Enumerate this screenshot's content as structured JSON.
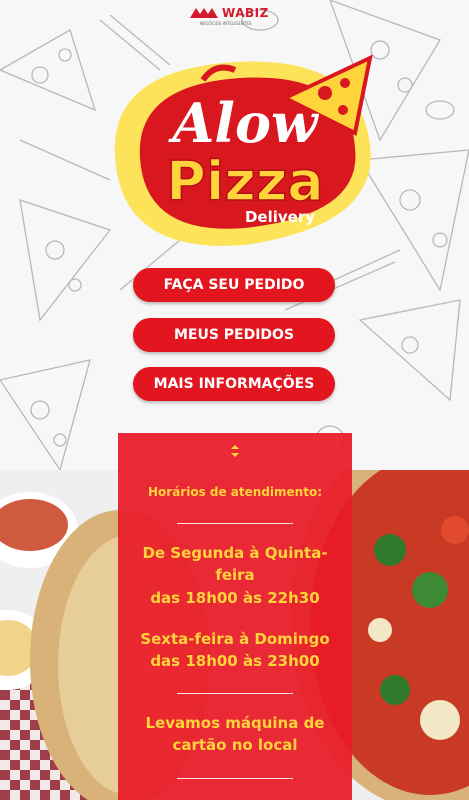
{
  "brand": {
    "name": "WABIZ",
    "tagline": "NEGÓCIOS INTELIGENTES"
  },
  "logo": {
    "line1": "Alow",
    "line2": "Pizza",
    "line3": "Delivery"
  },
  "menu": {
    "order_label": "FAÇA SEU PEDIDO",
    "my_orders_label": "MEUS PEDIDOS",
    "more_info_label": "MAIS INFORMAÇÕES"
  },
  "info": {
    "hours_title": "Horários de atendimento:",
    "weekdays_1": "De Segunda à Quinta-",
    "weekdays_2": "feira",
    "weekdays_3": "das 18h00 às 22h30",
    "weekend_1": "Sexta-feira à Domingo",
    "weekend_2": "das 18h00 às 23h00",
    "card_1": "Levamos máquina de",
    "card_2": "cartão no local"
  },
  "colors": {
    "primary_red": "#e3151f",
    "accent_yellow": "#ffd43a"
  }
}
